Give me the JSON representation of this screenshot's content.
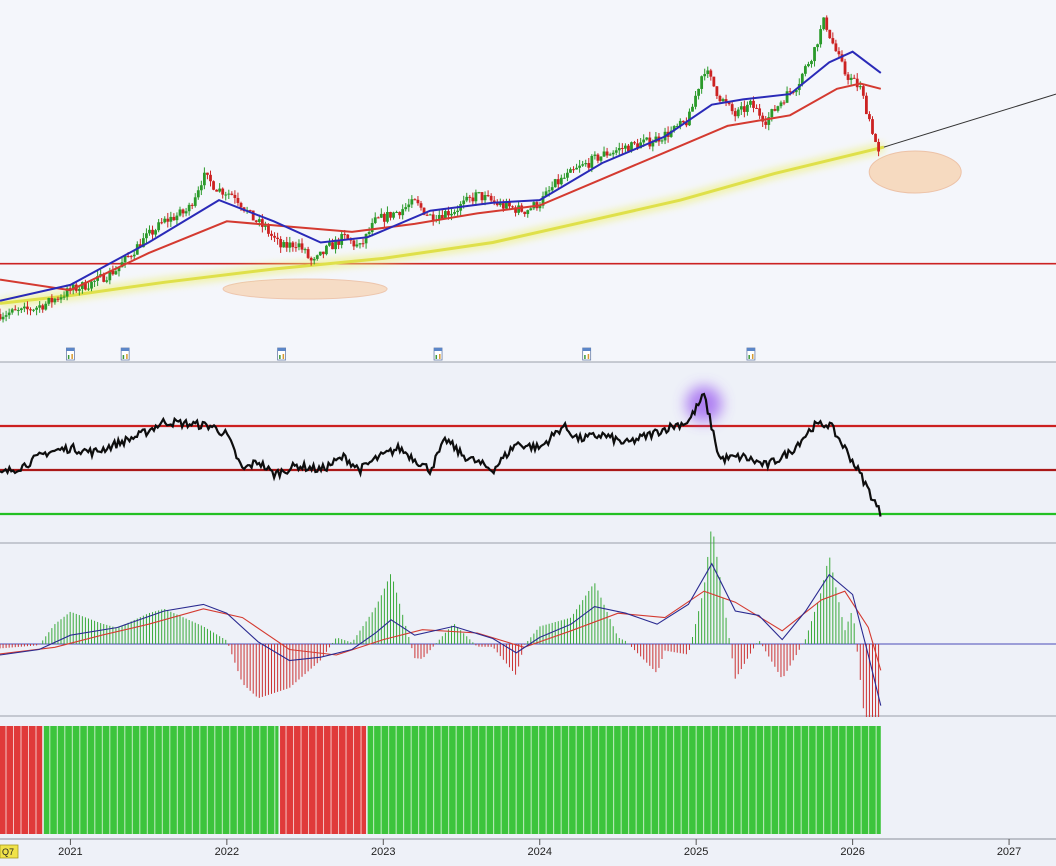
{
  "chart_data": {
    "type": "line",
    "x_axis": {
      "ticks": [
        "2021",
        "2022",
        "2023",
        "2024",
        "2025",
        "2026",
        "2027"
      ],
      "tick_years": [
        2021,
        2022,
        2023,
        2024,
        2025,
        2026,
        2027
      ],
      "left_label": "Q7",
      "range": [
        2020.55,
        2027.3
      ]
    },
    "panels": [
      {
        "name": "price",
        "type": "candlestick",
        "ylim": [
          0,
          100
        ],
        "horizontal_line": 22,
        "candles_sampled": [
          [
            2020.55,
            3
          ],
          [
            2020.7,
            4
          ],
          [
            2020.85,
            7
          ],
          [
            2021.0,
            12
          ],
          [
            2021.15,
            15
          ],
          [
            2021.3,
            20
          ],
          [
            2021.45,
            30
          ],
          [
            2021.6,
            38
          ],
          [
            2021.75,
            42
          ],
          [
            2021.85,
            55
          ],
          [
            2021.95,
            50
          ],
          [
            2022.05,
            48
          ],
          [
            2022.15,
            40
          ],
          [
            2022.25,
            35
          ],
          [
            2022.35,
            28
          ],
          [
            2022.45,
            30
          ],
          [
            2022.55,
            22
          ],
          [
            2022.65,
            28
          ],
          [
            2022.75,
            32
          ],
          [
            2022.85,
            28
          ],
          [
            2022.95,
            38
          ],
          [
            2023.1,
            42
          ],
          [
            2023.2,
            45
          ],
          [
            2023.3,
            40
          ],
          [
            2023.45,
            42
          ],
          [
            2023.6,
            48
          ],
          [
            2023.75,
            44
          ],
          [
            2023.9,
            42
          ],
          [
            2024.0,
            45
          ],
          [
            2024.1,
            52
          ],
          [
            2024.25,
            58
          ],
          [
            2024.4,
            63
          ],
          [
            2024.55,
            66
          ],
          [
            2024.7,
            68
          ],
          [
            2024.85,
            72
          ],
          [
            2024.95,
            76
          ],
          [
            2025.05,
            96
          ],
          [
            2025.15,
            85
          ],
          [
            2025.25,
            78
          ],
          [
            2025.35,
            82
          ],
          [
            2025.45,
            76
          ],
          [
            2025.55,
            84
          ],
          [
            2025.65,
            90
          ],
          [
            2025.75,
            102
          ],
          [
            2025.82,
            114
          ],
          [
            2025.88,
            104
          ],
          [
            2025.95,
            94
          ],
          [
            2026.05,
            88
          ],
          [
            2026.12,
            74
          ],
          [
            2026.18,
            60
          ]
        ],
        "ma_blue": [
          [
            2020.55,
            8
          ],
          [
            2021.0,
            14
          ],
          [
            2021.5,
            30
          ],
          [
            2021.95,
            46
          ],
          [
            2022.3,
            38
          ],
          [
            2022.6,
            30
          ],
          [
            2022.9,
            32
          ],
          [
            2023.3,
            42
          ],
          [
            2023.7,
            45
          ],
          [
            2024.0,
            46
          ],
          [
            2024.4,
            60
          ],
          [
            2024.8,
            70
          ],
          [
            2025.1,
            82
          ],
          [
            2025.3,
            84
          ],
          [
            2025.6,
            86
          ],
          [
            2025.85,
            98
          ],
          [
            2026.0,
            102
          ],
          [
            2026.18,
            94
          ]
        ],
        "ma_red": [
          [
            2020.55,
            16
          ],
          [
            2021.0,
            12
          ],
          [
            2021.5,
            26
          ],
          [
            2022.0,
            38
          ],
          [
            2022.4,
            36
          ],
          [
            2022.8,
            34
          ],
          [
            2023.2,
            37
          ],
          [
            2023.6,
            41
          ],
          [
            2024.0,
            44
          ],
          [
            2024.4,
            54
          ],
          [
            2024.8,
            64
          ],
          [
            2025.2,
            74
          ],
          [
            2025.6,
            78
          ],
          [
            2025.9,
            88
          ],
          [
            2026.05,
            90
          ],
          [
            2026.18,
            88
          ]
        ],
        "trend_yellow": [
          [
            2020.55,
            7
          ],
          [
            2021.0,
            10
          ],
          [
            2021.6,
            15
          ],
          [
            2022.3,
            20
          ],
          [
            2023.0,
            24
          ],
          [
            2023.7,
            30
          ],
          [
            2024.3,
            38
          ],
          [
            2024.9,
            46
          ],
          [
            2025.5,
            56
          ],
          [
            2026.2,
            66
          ]
        ],
        "projection_line": [
          [
            2026.2,
            66
          ],
          [
            2027.3,
            86
          ]
        ]
      },
      {
        "name": "oscillator",
        "type": "line",
        "ylim": [
          0,
          100
        ],
        "horizontal_lines": [
          {
            "value": 70,
            "color": "#cc2020"
          },
          {
            "value": 50,
            "color": "#aa1818"
          },
          {
            "value": 30,
            "color": "#22c022"
          }
        ],
        "values": [
          [
            2020.55,
            48
          ],
          [
            2020.7,
            52
          ],
          [
            2020.85,
            58
          ],
          [
            2021.0,
            60
          ],
          [
            2021.15,
            58
          ],
          [
            2021.3,
            62
          ],
          [
            2021.45,
            66
          ],
          [
            2021.6,
            72
          ],
          [
            2021.75,
            71
          ],
          [
            2021.9,
            70
          ],
          [
            2022.0,
            66
          ],
          [
            2022.1,
            50
          ],
          [
            2022.2,
            54
          ],
          [
            2022.3,
            48
          ],
          [
            2022.45,
            52
          ],
          [
            2022.6,
            50
          ],
          [
            2022.75,
            56
          ],
          [
            2022.85,
            50
          ],
          [
            2022.95,
            55
          ],
          [
            2023.1,
            60
          ],
          [
            2023.2,
            55
          ],
          [
            2023.3,
            50
          ],
          [
            2023.4,
            64
          ],
          [
            2023.5,
            57
          ],
          [
            2023.7,
            50
          ],
          [
            2023.85,
            62
          ],
          [
            2024.0,
            60
          ],
          [
            2024.15,
            70
          ],
          [
            2024.25,
            64
          ],
          [
            2024.4,
            66
          ],
          [
            2024.55,
            62
          ],
          [
            2024.7,
            66
          ],
          [
            2024.85,
            70
          ],
          [
            2024.95,
            72
          ],
          [
            2025.05,
            84
          ],
          [
            2025.15,
            55
          ],
          [
            2025.3,
            56
          ],
          [
            2025.45,
            52
          ],
          [
            2025.6,
            58
          ],
          [
            2025.75,
            70
          ],
          [
            2025.85,
            71
          ],
          [
            2025.95,
            60
          ],
          [
            2026.05,
            48
          ],
          [
            2026.18,
            30
          ]
        ]
      },
      {
        "name": "macd",
        "type": "line",
        "ylim": [
          -10,
          10
        ],
        "zero_line": 0,
        "macd_blue": [
          [
            2020.55,
            -1
          ],
          [
            2020.8,
            -0.5
          ],
          [
            2021.0,
            0.8
          ],
          [
            2021.3,
            1.5
          ],
          [
            2021.6,
            3
          ],
          [
            2021.85,
            3.6
          ],
          [
            2022.0,
            2.8
          ],
          [
            2022.2,
            0.2
          ],
          [
            2022.4,
            -1.5
          ],
          [
            2022.6,
            -1.2
          ],
          [
            2022.8,
            -0.5
          ],
          [
            2022.95,
            1
          ],
          [
            2023.05,
            2.2
          ],
          [
            2023.2,
            0.8
          ],
          [
            2023.45,
            1.6
          ],
          [
            2023.7,
            0.5
          ],
          [
            2023.85,
            -0.8
          ],
          [
            2024.0,
            0.6
          ],
          [
            2024.2,
            1.8
          ],
          [
            2024.35,
            3.4
          ],
          [
            2024.55,
            2.8
          ],
          [
            2024.75,
            1.8
          ],
          [
            2024.95,
            3.6
          ],
          [
            2025.1,
            7.3
          ],
          [
            2025.25,
            3
          ],
          [
            2025.4,
            2.6
          ],
          [
            2025.55,
            0.4
          ],
          [
            2025.7,
            3
          ],
          [
            2025.85,
            6.3
          ],
          [
            2026.0,
            4.5
          ],
          [
            2026.1,
            -1
          ],
          [
            2026.18,
            -5.6
          ]
        ],
        "signal_red": [
          [
            2020.55,
            -0.9
          ],
          [
            2020.9,
            -0.3
          ],
          [
            2021.2,
            0.8
          ],
          [
            2021.5,
            1.8
          ],
          [
            2021.85,
            3.2
          ],
          [
            2022.1,
            2.4
          ],
          [
            2022.4,
            -0.5
          ],
          [
            2022.7,
            -1
          ],
          [
            2023.0,
            0.4
          ],
          [
            2023.25,
            1.3
          ],
          [
            2023.6,
            1
          ],
          [
            2023.9,
            -0.3
          ],
          [
            2024.2,
            1.2
          ],
          [
            2024.5,
            2.8
          ],
          [
            2024.8,
            2.4
          ],
          [
            2025.05,
            4.8
          ],
          [
            2025.25,
            3.8
          ],
          [
            2025.55,
            1.2
          ],
          [
            2025.8,
            4
          ],
          [
            2025.95,
            4.8
          ],
          [
            2026.1,
            1.5
          ],
          [
            2026.18,
            -2.4
          ]
        ]
      },
      {
        "name": "regime",
        "type": "bar",
        "segments": [
          {
            "start": 2020.55,
            "end": 2020.82,
            "color": "red"
          },
          {
            "start": 2020.83,
            "end": 2022.33,
            "color": "green"
          },
          {
            "start": 2022.34,
            "end": 2022.89,
            "color": "red"
          },
          {
            "start": 2022.9,
            "end": 2026.18,
            "color": "green"
          }
        ]
      }
    ]
  }
}
